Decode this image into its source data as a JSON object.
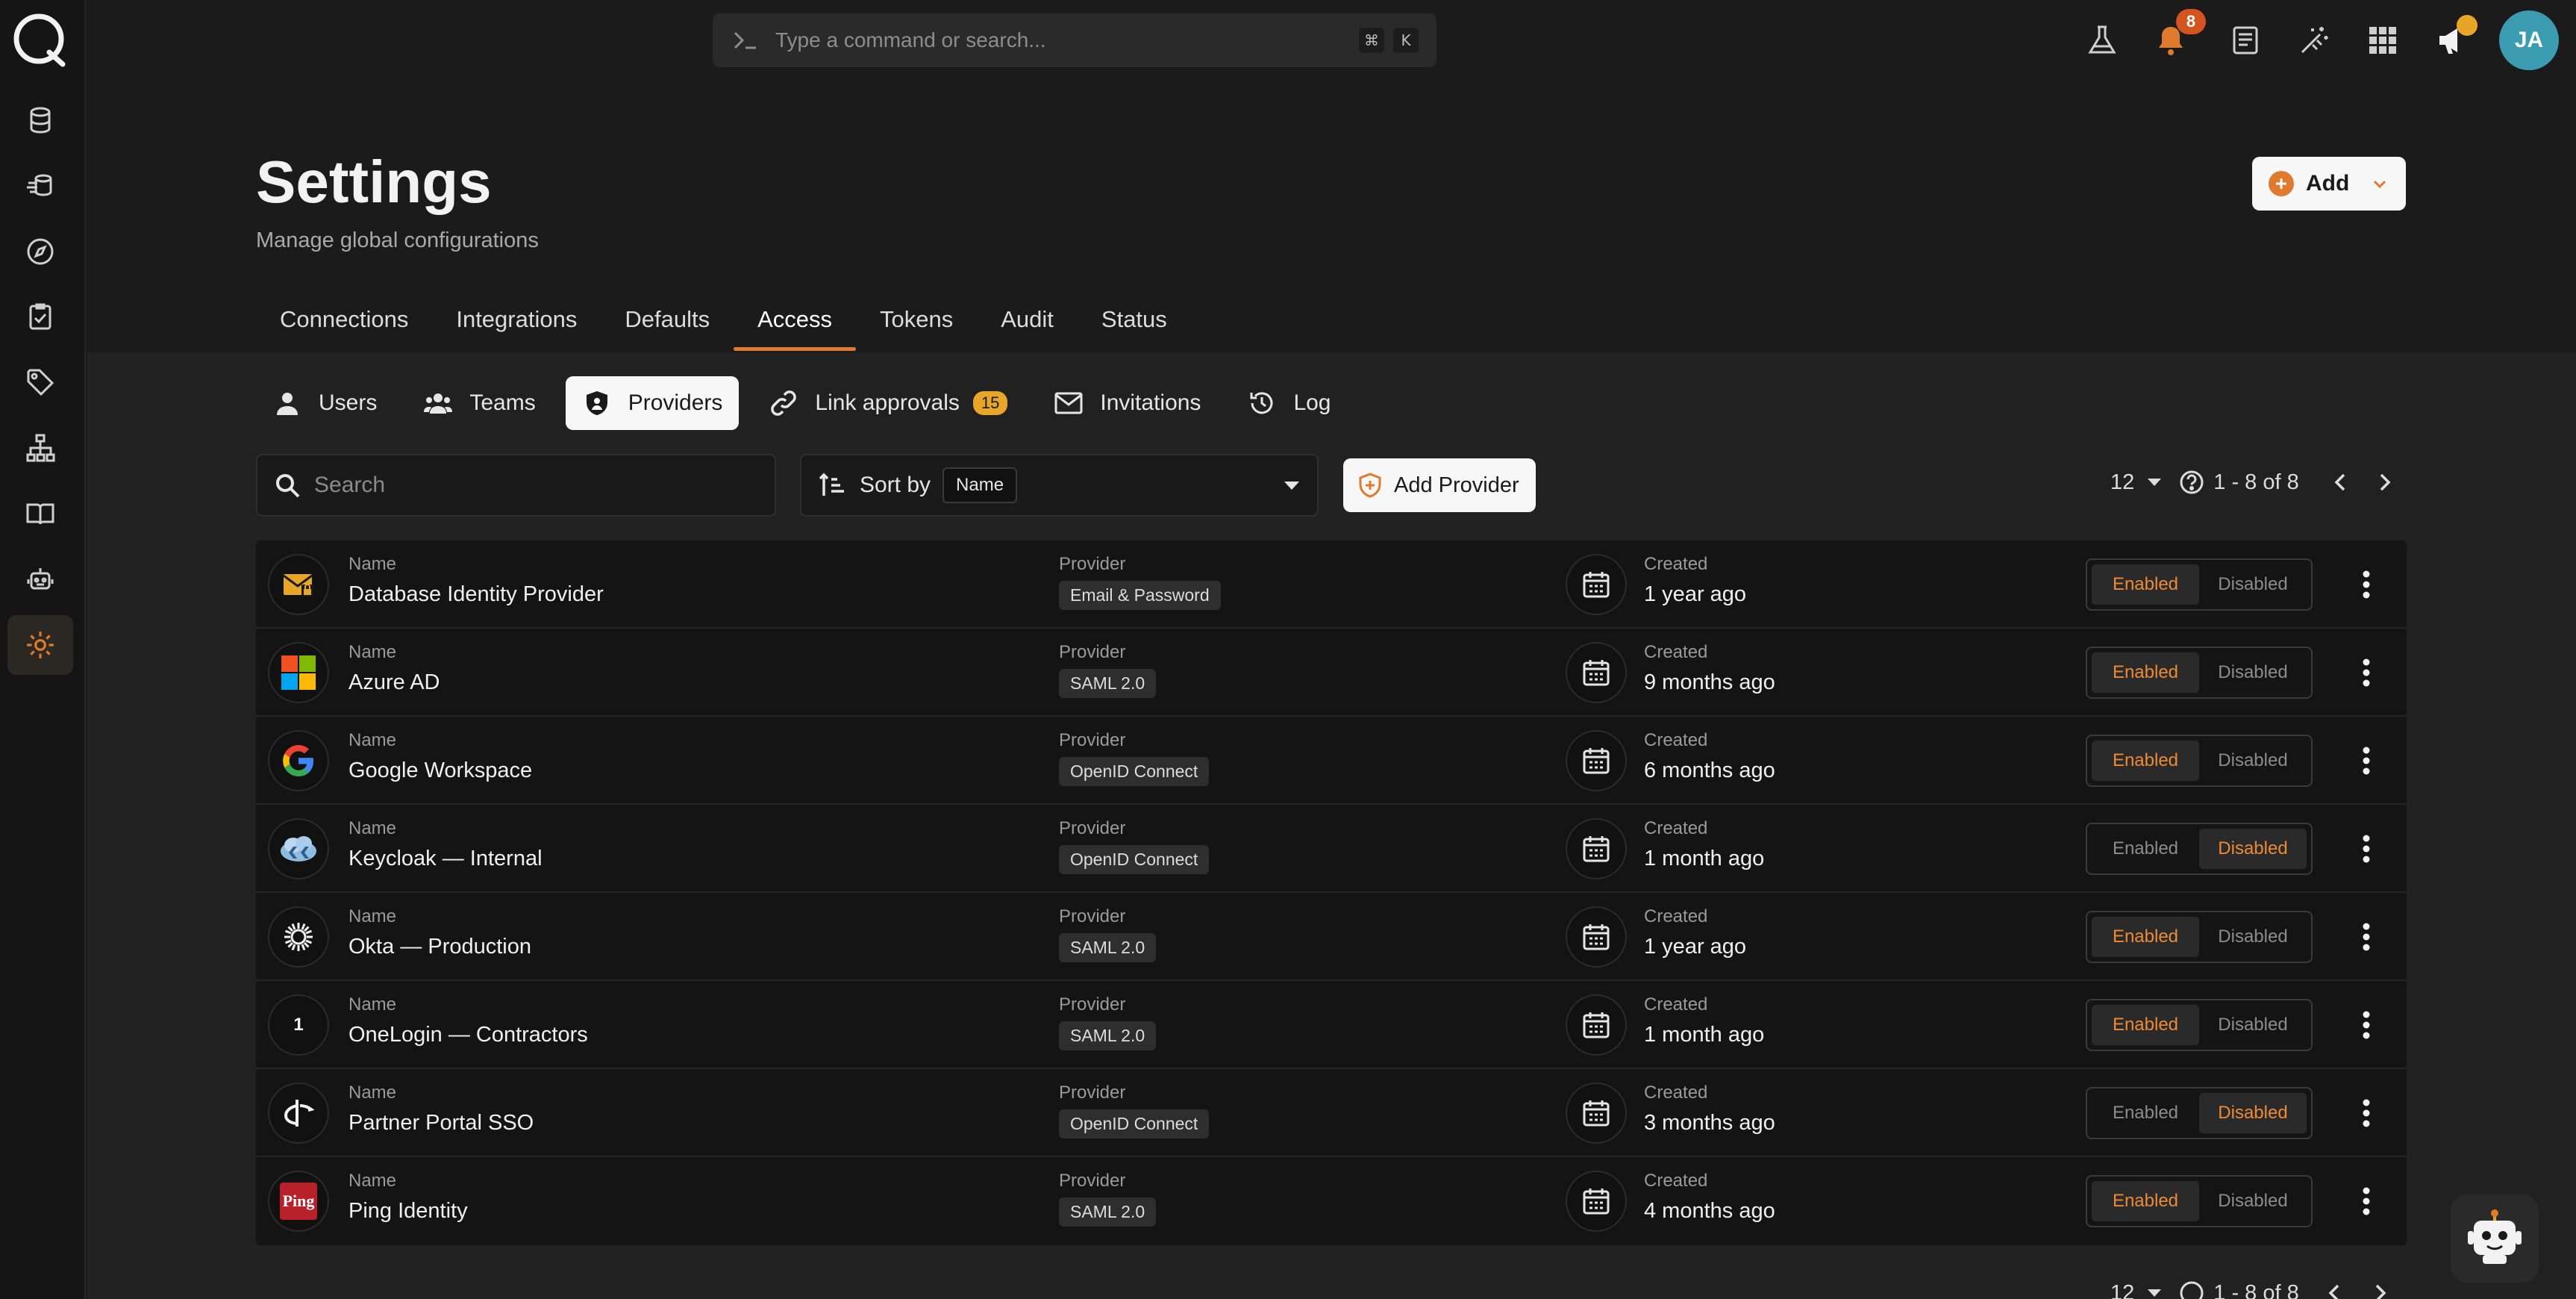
{
  "topbar": {
    "command_placeholder": "Type a command or search...",
    "shortcut_keys": [
      "⌘",
      "K"
    ],
    "notifications_count": "8",
    "avatar_initials": "JA"
  },
  "header": {
    "title": "Settings",
    "subtitle": "Manage global configurations",
    "add_label": "Add"
  },
  "tabs": [
    "Connections",
    "Integrations",
    "Defaults",
    "Access",
    "Tokens",
    "Audit",
    "Status"
  ],
  "active_tab": "Access",
  "subtabs": [
    {
      "label": "Users",
      "icon": "user-icon"
    },
    {
      "label": "Teams",
      "icon": "team-icon"
    },
    {
      "label": "Providers",
      "icon": "shield-icon"
    },
    {
      "label": "Link approvals",
      "icon": "link-icon",
      "count": "15"
    },
    {
      "label": "Invitations",
      "icon": "mail-icon"
    },
    {
      "label": "Log",
      "icon": "history-icon"
    }
  ],
  "active_subtab": "Providers",
  "toolbar": {
    "search_placeholder": "Search",
    "sort_label": "Sort by",
    "sort_value": "Name",
    "add_provider_label": "Add Provider"
  },
  "pagination": {
    "page_size": "12",
    "range": "1 - 8 of 8"
  },
  "columns": {
    "name": "Name",
    "provider": "Provider",
    "created": "Created"
  },
  "toggle_labels": {
    "enabled": "Enabled",
    "disabled": "Disabled"
  },
  "providers": [
    {
      "name": "Database Identity Provider",
      "provider": "Email & Password",
      "created": "1 year ago",
      "enabled": true,
      "logo": "database-mail-icon"
    },
    {
      "name": "Azure AD",
      "provider": "SAML 2.0",
      "created": "9 months ago",
      "enabled": true,
      "logo": "microsoft-logo"
    },
    {
      "name": "Google Workspace",
      "provider": "OpenID Connect",
      "created": "6 months ago",
      "enabled": true,
      "logo": "google-logo"
    },
    {
      "name": "Keycloak — Internal",
      "provider": "OpenID Connect",
      "created": "1 month ago",
      "enabled": false,
      "logo": "keycloak-logo"
    },
    {
      "name": "Okta — Production",
      "provider": "SAML 2.0",
      "created": "1 year ago",
      "enabled": true,
      "logo": "okta-logo"
    },
    {
      "name": "OneLogin — Contractors",
      "provider": "SAML 2.0",
      "created": "1 month ago",
      "enabled": true,
      "logo": "onelogin-logo"
    },
    {
      "name": "Partner Portal SSO",
      "provider": "OpenID Connect",
      "created": "3 months ago",
      "enabled": false,
      "logo": "openid-logo"
    },
    {
      "name": "Ping Identity",
      "provider": "SAML 2.0",
      "created": "4 months ago",
      "enabled": true,
      "logo": "ping-logo"
    }
  ],
  "ping_logo_text": "Ping",
  "onelogin_logo_text": "1",
  "sidebar_icons": [
    "database-icon",
    "pipeline-icon",
    "compass-icon",
    "checklist-icon",
    "tag-icon",
    "hierarchy-icon",
    "book-icon",
    "robot-icon",
    "gear-icon"
  ],
  "colors": {
    "accent": "#e07a2e",
    "badge": "#e8a628",
    "avatar": "#3a9bb1"
  }
}
